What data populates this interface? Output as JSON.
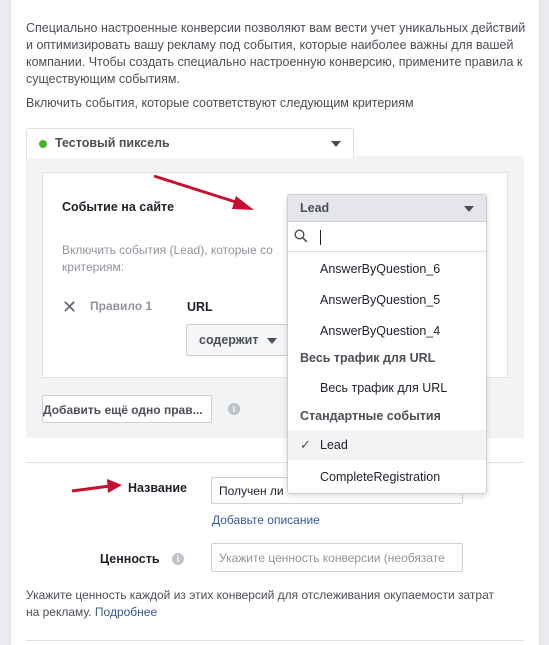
{
  "intro_text": "Специально настроенные конверсии позволяют вам вести учет уникальных действий и оптимизировать вашу рекламу под события, которые наиболее важны для вашей компании. Чтобы создать специально настроенную конверсию, примените правила к существующим событиям.",
  "criteria_text": "Включить события, которые соответствуют следующим критериям",
  "pixel": {
    "name": "Тестовый пиксель",
    "status_color": "#42b72a"
  },
  "event": {
    "label": "Событие на сайте",
    "include_text": "Включить события (Lead), которые со критериям:"
  },
  "rule": {
    "label": "Правило 1",
    "field": "URL",
    "operator": "содержит"
  },
  "add_rule_label": "Добавить ещё одно прав...",
  "dropdown": {
    "selected": "Lead",
    "search_value": "",
    "items_top": [
      "AnswerByQuestion_6",
      "AnswerByQuestion_5",
      "AnswerByQuestion_4"
    ],
    "section_url": "Весь трафик для URL",
    "item_url": "Весь трафик для URL",
    "section_standard": "Стандартные события",
    "item_lead": "Lead",
    "item_complete": "CompleteRegistration"
  },
  "name_field": {
    "label": "Название",
    "value": "Получен ли"
  },
  "add_description": "Добавьте описание",
  "value_field": {
    "label": "Ценность",
    "placeholder": "Укажите ценность конверсии (необязате"
  },
  "footnote": {
    "text": "Укажите ценность каждой из этих конверсий для отслеживания окупаемости затрат на рекламу.",
    "link": "Подробнее"
  },
  "colors": {
    "link": "#365899",
    "arrow": "#c8102e"
  }
}
